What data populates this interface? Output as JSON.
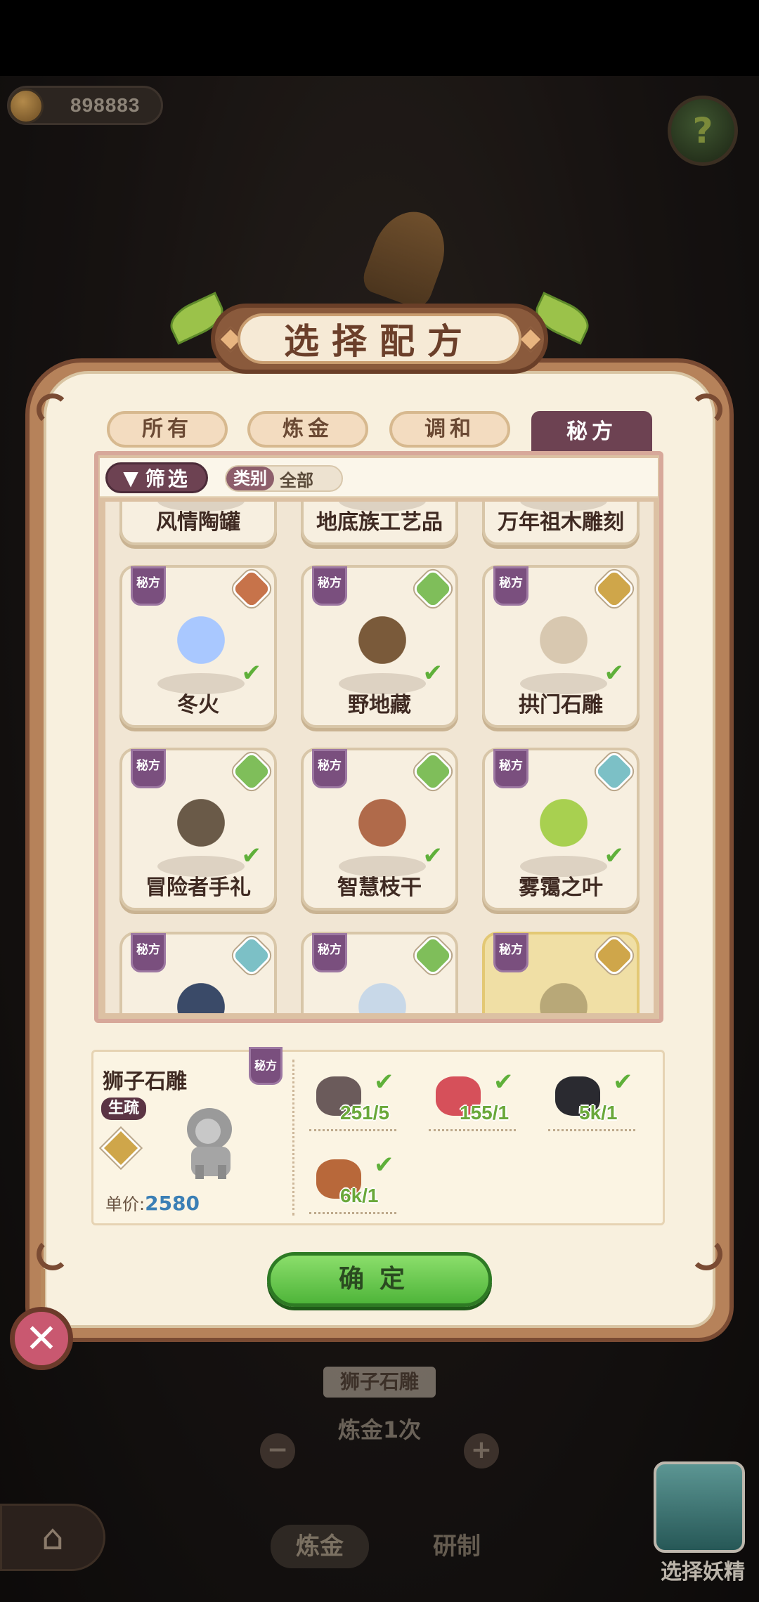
{
  "hud": {
    "coins": "898883",
    "help_icon": "help-question-icon"
  },
  "dialog": {
    "title": "选择配方",
    "tabs": [
      {
        "label": "所有",
        "active": false
      },
      {
        "label": "炼金",
        "active": false
      },
      {
        "label": "调和",
        "active": false
      },
      {
        "label": "秘方",
        "active": true
      }
    ],
    "filter_label": "筛选",
    "category_key": "类别",
    "category_value": "全部",
    "recipe_badge": "秘方",
    "recipes": [
      {
        "name": "风情陶罐",
        "gem": "#c7734a",
        "checked": true
      },
      {
        "name": "地底族工艺品",
        "gem": "#7cc0c6",
        "checked": true
      },
      {
        "name": "万年祖木雕刻",
        "gem": "#cfa64a",
        "checked": true
      },
      {
        "name": "冬火",
        "gem": "#c7734a",
        "checked": true
      },
      {
        "name": "野地藏",
        "gem": "#7fbe5a",
        "checked": true
      },
      {
        "name": "拱门石雕",
        "gem": "#cfa64a",
        "checked": true
      },
      {
        "name": "冒险者手礼",
        "gem": "#7fbe5a",
        "checked": true
      },
      {
        "name": "智慧枝干",
        "gem": "#7fbe5a",
        "checked": true
      },
      {
        "name": "雾霭之叶",
        "gem": "#7cc0c6",
        "checked": true
      },
      {
        "name": "",
        "gem": "#7cc0c6",
        "checked": false
      },
      {
        "name": "",
        "gem": "#7fbe5a",
        "checked": false
      },
      {
        "name": "",
        "gem": "#cfa64a",
        "checked": false,
        "selected": true
      }
    ],
    "detail": {
      "name": "狮子石雕",
      "rarity": "生疏",
      "badge": "秘方",
      "price_label": "单价:",
      "price_value": "2580",
      "ingredients": [
        {
          "qty": "251/5",
          "color": "#6b5b5b",
          "checked": true
        },
        {
          "qty": "155/1",
          "color": "#d6505a",
          "checked": true
        },
        {
          "qty": "5k/1",
          "color": "#2a2a30",
          "checked": true
        },
        {
          "qty": "6k/1",
          "color": "#b8683a",
          "checked": true
        }
      ]
    },
    "confirm_label": "确定",
    "close_icon": "close-x-icon"
  },
  "background": {
    "selected_label": "狮子石雕",
    "alchemy_count": "炼金1次",
    "tab_alchemy": "炼金",
    "tab_research": "研制",
    "elf_label": "选择妖精",
    "home_icon": "home-icon"
  },
  "colors": {
    "accent_purple": "#6d4252",
    "confirm_green": "#4fb53a",
    "price_blue": "#3b7fb5",
    "qty_green": "#6aa83a"
  }
}
